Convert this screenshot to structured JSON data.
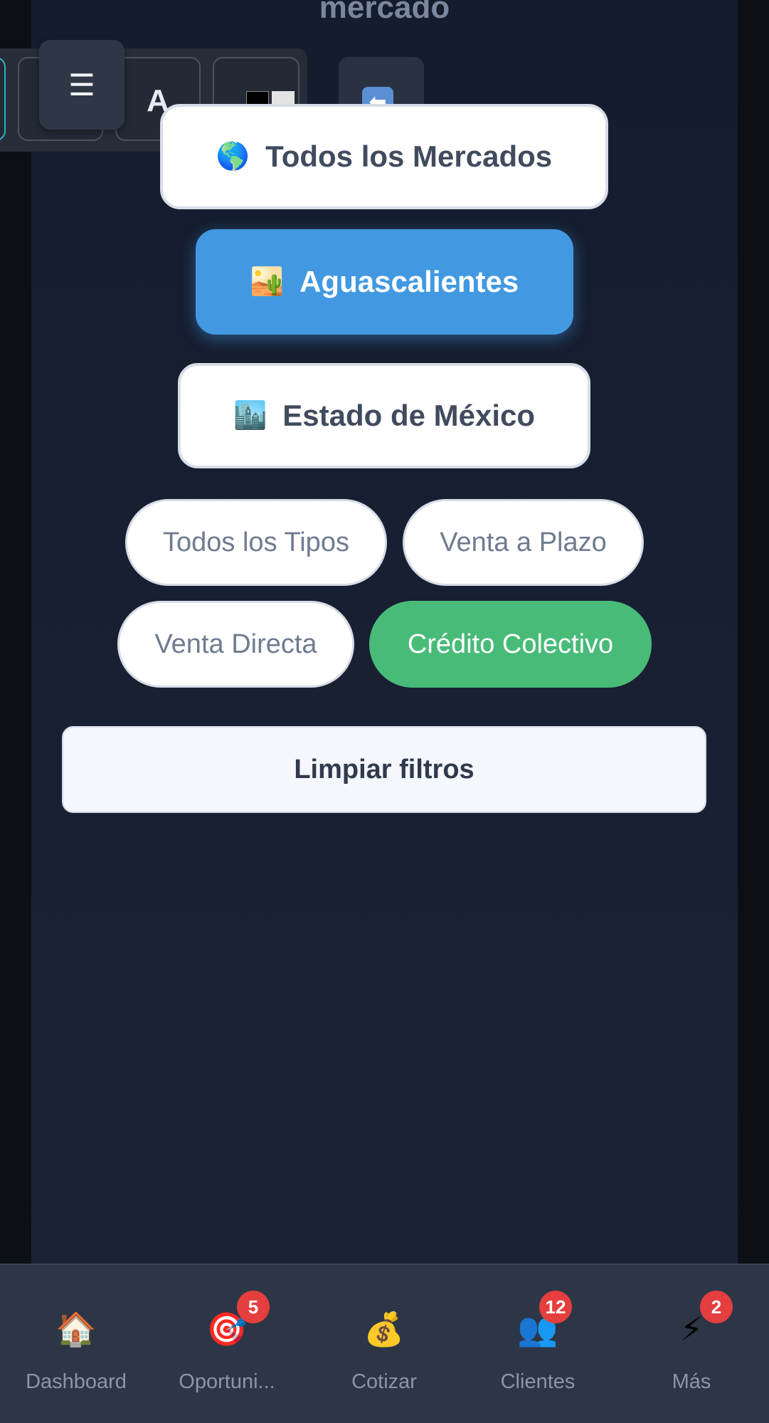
{
  "header": {
    "title": "mercado"
  },
  "toolbar": {
    "menu_icon": "☰",
    "font_size_label": "A",
    "contrast_icon": "contrast-icon",
    "back_icon": "⬅"
  },
  "markets": [
    {
      "emoji": "🌎",
      "label": "Todos los Mercados",
      "selected": false
    },
    {
      "emoji": "🏜️",
      "label": "Aguascalientes",
      "selected": true
    },
    {
      "emoji": "🏙️",
      "label": "Estado de México",
      "selected": false
    }
  ],
  "types": [
    {
      "label": "Todos los Tipos",
      "selected": false
    },
    {
      "label": "Venta a Plazo",
      "selected": false
    },
    {
      "label": "Venta Directa",
      "selected": false
    },
    {
      "label": "Crédito Colectivo",
      "selected": true
    }
  ],
  "clear_filters_label": "Limpiar filtros",
  "bottom_nav": [
    {
      "icon": "🏠",
      "label": "Dashboard",
      "badge": ""
    },
    {
      "icon": "🎯",
      "label": "Oportuni...",
      "badge": "5"
    },
    {
      "icon": "💰",
      "label": "Cotizar",
      "badge": ""
    },
    {
      "icon": "👥",
      "label": "Clientes",
      "badge": "12"
    },
    {
      "icon": "⚡",
      "label": "Más",
      "badge": "2"
    }
  ],
  "colors": {
    "selected_market": "#4299e1",
    "selected_type": "#48bb78",
    "badge": "#e53e3e"
  }
}
